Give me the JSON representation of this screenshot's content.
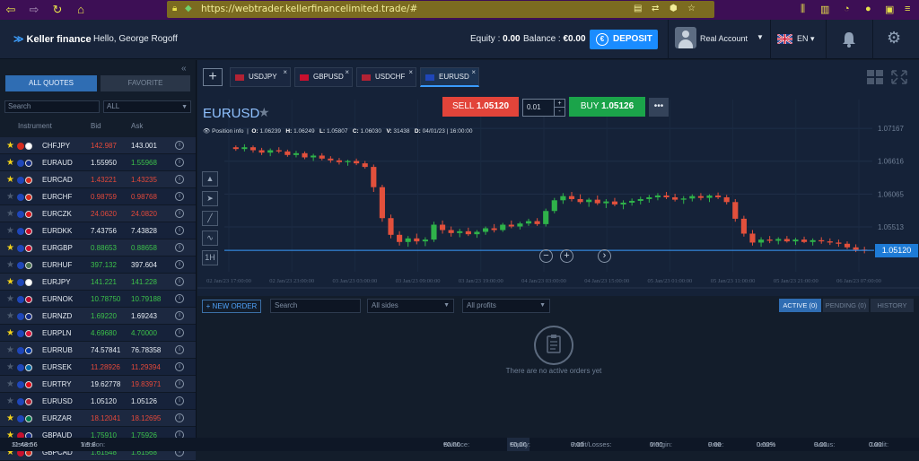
{
  "browser": {
    "url": "https://webtrader.kellerfinancelimited.trade/#"
  },
  "header": {
    "brand": "Keller finance",
    "greeting": "Hello, George Rogoff",
    "equity_label": "Equity :",
    "equity_value": "0.00",
    "balance_label": "Balance :",
    "balance_value": "€0.00",
    "deposit_label": "DEPOSIT",
    "account_type": "Real Account",
    "language": "EN"
  },
  "quotes_panel": {
    "tab_all": "ALL QUOTES",
    "tab_favorite": "FAVORITE",
    "search_placeholder": "Search",
    "filter_value": "ALL",
    "col_instrument": "Instrument",
    "col_bid": "Bid",
    "col_ask": "Ask",
    "rows": [
      {
        "fav": true,
        "symbol": "CHFJPY",
        "bid": "142.987",
        "ask": "143.001",
        "bid_color": "r",
        "ask_color": "w",
        "flags": [
          "#d52b1e",
          "#ffffff"
        ]
      },
      {
        "fav": true,
        "symbol": "EURAUD",
        "bid": "1.55950",
        "ask": "1.55968",
        "bid_color": "w",
        "ask_color": "g",
        "flags": [
          "#1f46b8",
          "#132c88"
        ]
      },
      {
        "fav": true,
        "symbol": "EURCAD",
        "bid": "1.43221",
        "ask": "1.43235",
        "bid_color": "r",
        "ask_color": "r",
        "flags": [
          "#1f46b8",
          "#d52b1e"
        ]
      },
      {
        "fav": false,
        "symbol": "EURCHF",
        "bid": "0.98759",
        "ask": "0.98768",
        "bid_color": "r",
        "ask_color": "r",
        "flags": [
          "#1f46b8",
          "#d52b1e"
        ]
      },
      {
        "fav": false,
        "symbol": "EURCZK",
        "bid": "24.0620",
        "ask": "24.0820",
        "bid_color": "r",
        "ask_color": "r",
        "flags": [
          "#1f46b8",
          "#d7141a"
        ]
      },
      {
        "fav": false,
        "symbol": "EURDKK",
        "bid": "7.43756",
        "ask": "7.43828",
        "bid_color": "w",
        "ask_color": "w",
        "flags": [
          "#1f46b8",
          "#c8102e"
        ]
      },
      {
        "fav": true,
        "symbol": "EURGBP",
        "bid": "0.88653",
        "ask": "0.88658",
        "bid_color": "g",
        "ask_color": "g",
        "flags": [
          "#1f46b8",
          "#c8102e"
        ]
      },
      {
        "fav": false,
        "symbol": "EURHUF",
        "bid": "397.132",
        "ask": "397.604",
        "bid_color": "g",
        "ask_color": "w",
        "flags": [
          "#1f46b8",
          "#477050"
        ]
      },
      {
        "fav": true,
        "symbol": "EURJPY",
        "bid": "141.221",
        "ask": "141.228",
        "bid_color": "g",
        "ask_color": "g",
        "flags": [
          "#1f46b8",
          "#ffffff"
        ]
      },
      {
        "fav": false,
        "symbol": "EURNOK",
        "bid": "10.78750",
        "ask": "10.79188",
        "bid_color": "g",
        "ask_color": "g",
        "flags": [
          "#1f46b8",
          "#ba0c2f"
        ]
      },
      {
        "fav": false,
        "symbol": "EURNZD",
        "bid": "1.69220",
        "ask": "1.69243",
        "bid_color": "g",
        "ask_color": "w",
        "flags": [
          "#1f46b8",
          "#132c88"
        ]
      },
      {
        "fav": true,
        "symbol": "EURPLN",
        "bid": "4.69680",
        "ask": "4.70000",
        "bid_color": "g",
        "ask_color": "g",
        "flags": [
          "#1f46b8",
          "#dc143c"
        ]
      },
      {
        "fav": false,
        "symbol": "EURRUB",
        "bid": "74.57841",
        "ask": "76.78358",
        "bid_color": "w",
        "ask_color": "w",
        "flags": [
          "#1f46b8",
          "#0039a6"
        ]
      },
      {
        "fav": false,
        "symbol": "EURSEK",
        "bid": "11.28926",
        "ask": "11.29394",
        "bid_color": "r",
        "ask_color": "r",
        "flags": [
          "#1f46b8",
          "#006aa7"
        ]
      },
      {
        "fav": false,
        "symbol": "EURTRY",
        "bid": "19.62778",
        "ask": "19.83971",
        "bid_color": "w",
        "ask_color": "r",
        "flags": [
          "#1f46b8",
          "#e30a17"
        ]
      },
      {
        "fav": false,
        "symbol": "EURUSD",
        "bid": "1.05120",
        "ask": "1.05126",
        "bid_color": "w",
        "ask_color": "w",
        "flags": [
          "#1f46b8",
          "#b22234"
        ]
      },
      {
        "fav": true,
        "symbol": "EURZAR",
        "bid": "18.12041",
        "ask": "18.12695",
        "bid_color": "r",
        "ask_color": "r",
        "flags": [
          "#1f46b8",
          "#007a4d"
        ]
      },
      {
        "fav": true,
        "symbol": "GBPAUD",
        "bid": "1.75910",
        "ask": "1.75926",
        "bid_color": "g",
        "ask_color": "g",
        "flags": [
          "#c8102e",
          "#132c88"
        ]
      },
      {
        "fav": true,
        "symbol": "GBPCAD",
        "bid": "1.61548",
        "ask": "1.61568",
        "bid_color": "g",
        "ask_color": "g",
        "flags": [
          "#c8102e",
          "#d52b1e"
        ]
      }
    ]
  },
  "chart_tabs": [
    {
      "label": "USDJPY",
      "flag": "#b22234"
    },
    {
      "label": "GBPUSD",
      "flag": "#c8102e"
    },
    {
      "label": "USDCHF",
      "flag": "#b22234"
    },
    {
      "label": "EURUSD",
      "flag": "#1f46b8"
    }
  ],
  "trade": {
    "symbol": "EURUSD",
    "sell_label": "SELL",
    "sell_price": "1.05120",
    "lot": "0.01",
    "buy_label": "BUY",
    "buy_price": "1.05126",
    "more": "•••"
  },
  "ohlc": {
    "position_info": "Position info",
    "o_label": "O:",
    "o": "1.06239",
    "h_label": "H:",
    "h": "1.06249",
    "l_label": "L:",
    "l": "1.05807",
    "c_label": "C:",
    "c": "1.06030",
    "v_label": "V:",
    "v": "31438",
    "d_label": "D:",
    "d": "04/01/23 | 16:00:00"
  },
  "tools": [
    "▲",
    "➤",
    "╱",
    "∿",
    "1H"
  ],
  "chart_data": {
    "type": "candlestick",
    "y_ticks": [
      "1.07167",
      "1.06616",
      "1.06065",
      "1.05513"
    ],
    "y_tick_values": [
      1.07167,
      1.06616,
      1.06065,
      1.05513
    ],
    "ylim": [
      1.0476,
      1.0744
    ],
    "x_ticks": [
      "02 Jan/23 17:00:00",
      "02 Jan/23 23:00:00",
      "03 Jan/23 03:00:00",
      "03 Jan/23 09:00:00",
      "03 Jan/23 19:00:00",
      "04 Jan/23 03:00:00",
      "04 Jan/23 15:00:00",
      "05 Jan/23 01:00:00",
      "05 Jan/23 11:00:00",
      "05 Jan/23 21:00:00",
      "06 Jan/23 07:00:00"
    ],
    "current_price": "1.05120",
    "current_price_value": 1.0512,
    "candles": [
      [
        1.0685,
        1.0688,
        1.0679,
        1.0682
      ],
      [
        1.0682,
        1.069,
        1.0678,
        1.0685
      ],
      [
        1.0685,
        1.0688,
        1.0676,
        1.068
      ],
      [
        1.068,
        1.0684,
        1.0672,
        1.0676
      ],
      [
        1.0676,
        1.0683,
        1.067,
        1.068
      ],
      [
        1.068,
        1.0685,
        1.0675,
        1.0678
      ],
      [
        1.0678,
        1.0681,
        1.0669,
        1.0672
      ],
      [
        1.0672,
        1.0679,
        1.0668,
        1.0675
      ],
      [
        1.0675,
        1.0678,
        1.0665,
        1.0668
      ],
      [
        1.0668,
        1.0674,
        1.0662,
        1.0671
      ],
      [
        1.0671,
        1.0675,
        1.0663,
        1.0666
      ],
      [
        1.0666,
        1.067,
        1.0659,
        1.0663
      ],
      [
        1.0663,
        1.0667,
        1.0656,
        1.066
      ],
      [
        1.066,
        1.0664,
        1.0654,
        1.0662
      ],
      [
        1.0662,
        1.0666,
        1.0655,
        1.0658
      ],
      [
        1.0658,
        1.0662,
        1.0649,
        1.0652
      ],
      [
        1.0652,
        1.0656,
        1.061,
        1.0618
      ],
      [
        1.0618,
        1.0622,
        1.056,
        1.0566
      ],
      [
        1.0566,
        1.0572,
        1.0532,
        1.0538
      ],
      [
        1.0538,
        1.0544,
        1.052,
        1.0526
      ],
      [
        1.0526,
        1.0536,
        1.0518,
        1.0532
      ],
      [
        1.0532,
        1.054,
        1.0522,
        1.0527
      ],
      [
        1.0527,
        1.0534,
        1.0519,
        1.053
      ],
      [
        1.053,
        1.056,
        1.0526,
        1.0555
      ],
      [
        1.0555,
        1.0562,
        1.054,
        1.0546
      ],
      [
        1.0546,
        1.0552,
        1.0535,
        1.0541
      ],
      [
        1.0541,
        1.0548,
        1.0534,
        1.0544
      ],
      [
        1.0544,
        1.055,
        1.0536,
        1.0539
      ],
      [
        1.0539,
        1.0546,
        1.0533,
        1.0543
      ],
      [
        1.0543,
        1.0552,
        1.0538,
        1.0549
      ],
      [
        1.0549,
        1.0556,
        1.0542,
        1.0546
      ],
      [
        1.0546,
        1.0558,
        1.0543,
        1.0555
      ],
      [
        1.0555,
        1.0562,
        1.0549,
        1.0552
      ],
      [
        1.0552,
        1.056,
        1.0547,
        1.0557
      ],
      [
        1.0557,
        1.0565,
        1.0553,
        1.0561
      ],
      [
        1.0561,
        1.0566,
        1.0553,
        1.0556
      ],
      [
        1.0556,
        1.0582,
        1.0552,
        1.0578
      ],
      [
        1.0578,
        1.06,
        1.0574,
        1.0596
      ],
      [
        1.0596,
        1.0608,
        1.059,
        1.0603
      ],
      [
        1.0603,
        1.061,
        1.0594,
        1.0598
      ],
      [
        1.0598,
        1.0606,
        1.059,
        1.0593
      ],
      [
        1.0593,
        1.06,
        1.0585,
        1.0597
      ],
      [
        1.0597,
        1.0604,
        1.0588,
        1.0591
      ],
      [
        1.0591,
        1.0598,
        1.0583,
        1.0594
      ],
      [
        1.0594,
        1.06,
        1.0586,
        1.0589
      ],
      [
        1.0589,
        1.0596,
        1.0581,
        1.0592
      ],
      [
        1.0592,
        1.0599,
        1.0587,
        1.0595
      ],
      [
        1.0595,
        1.0602,
        1.0589,
        1.0598
      ],
      [
        1.0598,
        1.0605,
        1.0592,
        1.0601
      ],
      [
        1.0601,
        1.0608,
        1.0596,
        1.0604
      ],
      [
        1.0604,
        1.061,
        1.0598,
        1.0601
      ],
      [
        1.0601,
        1.0607,
        1.0594,
        1.0597
      ],
      [
        1.0597,
        1.0603,
        1.059,
        1.0599
      ],
      [
        1.0599,
        1.0606,
        1.0594,
        1.0603
      ],
      [
        1.0603,
        1.0608,
        1.0596,
        1.06
      ],
      [
        1.06,
        1.0606,
        1.0593,
        1.0604
      ],
      [
        1.0604,
        1.0609,
        1.0598,
        1.0601
      ],
      [
        1.0601,
        1.0605,
        1.0589,
        1.0593
      ],
      [
        1.0593,
        1.0598,
        1.056,
        1.0565
      ],
      [
        1.0565,
        1.057,
        1.0535,
        1.054
      ],
      [
        1.054,
        1.0546,
        1.052,
        1.0525
      ],
      [
        1.0525,
        1.0534,
        1.0518,
        1.053
      ],
      [
        1.053,
        1.0536,
        1.0524,
        1.0528
      ],
      [
        1.0528,
        1.0534,
        1.0522,
        1.0531
      ],
      [
        1.0531,
        1.0536,
        1.0525,
        1.0527
      ],
      [
        1.0527,
        1.0533,
        1.0521,
        1.053
      ],
      [
        1.053,
        1.0535,
        1.0524,
        1.0526
      ],
      [
        1.0526,
        1.0532,
        1.052,
        1.0529
      ],
      [
        1.0529,
        1.0534,
        1.0523,
        1.0527
      ],
      [
        1.0527,
        1.0532,
        1.0521,
        1.0525
      ],
      [
        1.0525,
        1.053,
        1.0518,
        1.0523
      ],
      [
        1.0523,
        1.0527,
        1.0514,
        1.0517
      ],
      [
        1.0517,
        1.0522,
        1.0509,
        1.0513
      ],
      [
        1.0513,
        1.0518,
        1.0507,
        1.0512
      ]
    ]
  },
  "orders": {
    "new_order": "+ NEW ORDER",
    "search_placeholder": "Search",
    "sides_value": "All sides",
    "profits_value": "All profits",
    "tab_active": "ACTIVE (0)",
    "tab_pending": "PENDING (0)",
    "tab_history": "HISTORY",
    "empty_text": "There are no active orders yet"
  },
  "footer": {
    "server_label": "Server:",
    "server": "11:48:56",
    "version_label": "Version:",
    "version": "1.5.8",
    "balance_label": "Balance:",
    "balance": "€0.00",
    "equity_label": "Equity:",
    "equity": "€0.00",
    "pl_label": "Profit/Losses:",
    "pl": "0.00",
    "margin_label": "Margin:",
    "margin": "0.00",
    "free_label": "Free:",
    "free": "0.00",
    "level_label": "Level:",
    "level": "0.00%",
    "bonus_label": "Bonus:",
    "bonus": "0.00",
    "credit_label": "Credit:",
    "credit": "0.00"
  },
  "colors": {
    "sell": "#e2443a",
    "buy": "#1ba44a",
    "accent": "#1a8cff",
    "bull": "#2fb34a",
    "bear": "#e2503c"
  }
}
